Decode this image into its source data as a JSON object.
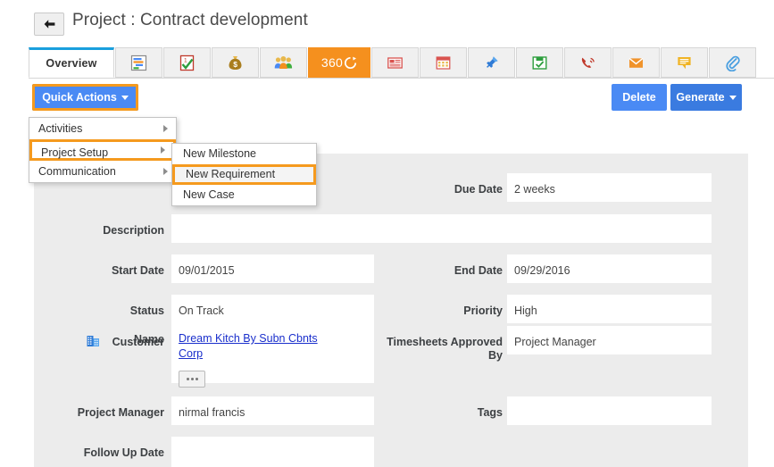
{
  "header": {
    "back_icon": "arrow-left-icon",
    "title": "Project : Contract development"
  },
  "tabs": [
    {
      "label": "Overview",
      "icon": "",
      "active": true
    },
    {
      "label": "",
      "icon": "gantt-chart-icon",
      "active": false
    },
    {
      "label": "",
      "icon": "task-checklist-icon",
      "active": false
    },
    {
      "label": "",
      "icon": "money-bag-icon",
      "active": false
    },
    {
      "label": "",
      "icon": "team-users-icon",
      "active": false
    },
    {
      "label": "360",
      "icon": "refresh-360-icon",
      "active": false
    },
    {
      "label": "",
      "icon": "news-list-icon",
      "active": false
    },
    {
      "label": "",
      "icon": "calendar-icon",
      "active": false
    },
    {
      "label": "",
      "icon": "pushpin-icon",
      "active": false
    },
    {
      "label": "",
      "icon": "save-check-icon",
      "active": false
    },
    {
      "label": "",
      "icon": "phone-call-icon",
      "active": false
    },
    {
      "label": "",
      "icon": "envelope-icon",
      "active": false
    },
    {
      "label": "",
      "icon": "note-icon",
      "active": false
    },
    {
      "label": "",
      "icon": "paperclip-icon",
      "active": false
    }
  ],
  "toolbar": {
    "quick_actions_label": "Quick Actions",
    "delete_label": "Delete",
    "generate_label": "Generate"
  },
  "menu_level1": {
    "items": [
      {
        "label": "Activities",
        "has_submenu": true,
        "highlighted": false
      },
      {
        "label": "Project Setup",
        "has_submenu": true,
        "highlighted": true
      },
      {
        "label": "Communication",
        "has_submenu": true,
        "highlighted": false
      }
    ]
  },
  "menu_level2": {
    "items": [
      {
        "label": "New Milestone",
        "highlighted": false
      },
      {
        "label": "New Requirement",
        "highlighted": true
      },
      {
        "label": "New Case",
        "highlighted": false
      }
    ]
  },
  "form": {
    "name": {
      "label": "Name",
      "value": ""
    },
    "due_date": {
      "label": "Due Date",
      "value": "2 weeks"
    },
    "description": {
      "label": "Description",
      "value": ""
    },
    "start_date": {
      "label": "Start Date",
      "value": "09/01/2015"
    },
    "end_date": {
      "label": "End Date",
      "value": "09/29/2016"
    },
    "status": {
      "label": "Status",
      "value": "On Track"
    },
    "priority": {
      "label": "Priority",
      "value": "High"
    },
    "customer": {
      "label": "Customer",
      "icon": "building-icon",
      "value": "Dream Kitch By Subn Cbnts Corp",
      "more_button": "more-options-button"
    },
    "timesheets_approved_by": {
      "label": "Timesheets Approved By",
      "value": "Project Manager"
    },
    "project_manager": {
      "label": "Project Manager",
      "value": "nirmal francis"
    },
    "tags": {
      "label": "Tags",
      "value": ""
    },
    "follow_up_date": {
      "label": "Follow Up Date",
      "value": ""
    }
  },
  "colors": {
    "accent_blue": "#4a8af4",
    "highlight_orange": "#f59a1e",
    "tab_active_border": "#1a9fdd",
    "tab_orange": "#f5901e",
    "panel_bg": "#ececec",
    "link_blue": "#1a2fcc"
  }
}
